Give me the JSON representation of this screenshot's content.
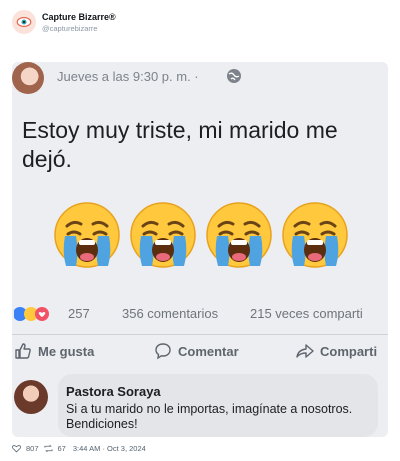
{
  "header": {
    "name": "Capture Bizarre®",
    "handle": "@capturebizarre",
    "avatar_icon": "eye-icon"
  },
  "post": {
    "meta": "Jueves a las 9:30 p. m. ·",
    "text": "Estoy muy triste, mi marido me dejó.",
    "emojis": [
      "crying-face",
      "crying-face",
      "crying-face",
      "crying-face"
    ],
    "reactions_count": "257",
    "comments": "356 comentarios",
    "shares": "215 veces comparti",
    "actions": {
      "like": "Me gusta",
      "comment": "Comentar",
      "share": "Comparti"
    }
  },
  "comment": {
    "author": "Pastora Soraya",
    "text": "Si a tu marido no le importas, imagínate a nosotros. Bendiciones!"
  },
  "footer": {
    "likes": "807",
    "retweets": "67",
    "timestamp": "3:44 AM · Oct 3, 2024"
  },
  "colors": {
    "accent": "#f08a5d",
    "emoji_yellow": "#ffc83d",
    "tear_blue": "#4fa3e0"
  }
}
